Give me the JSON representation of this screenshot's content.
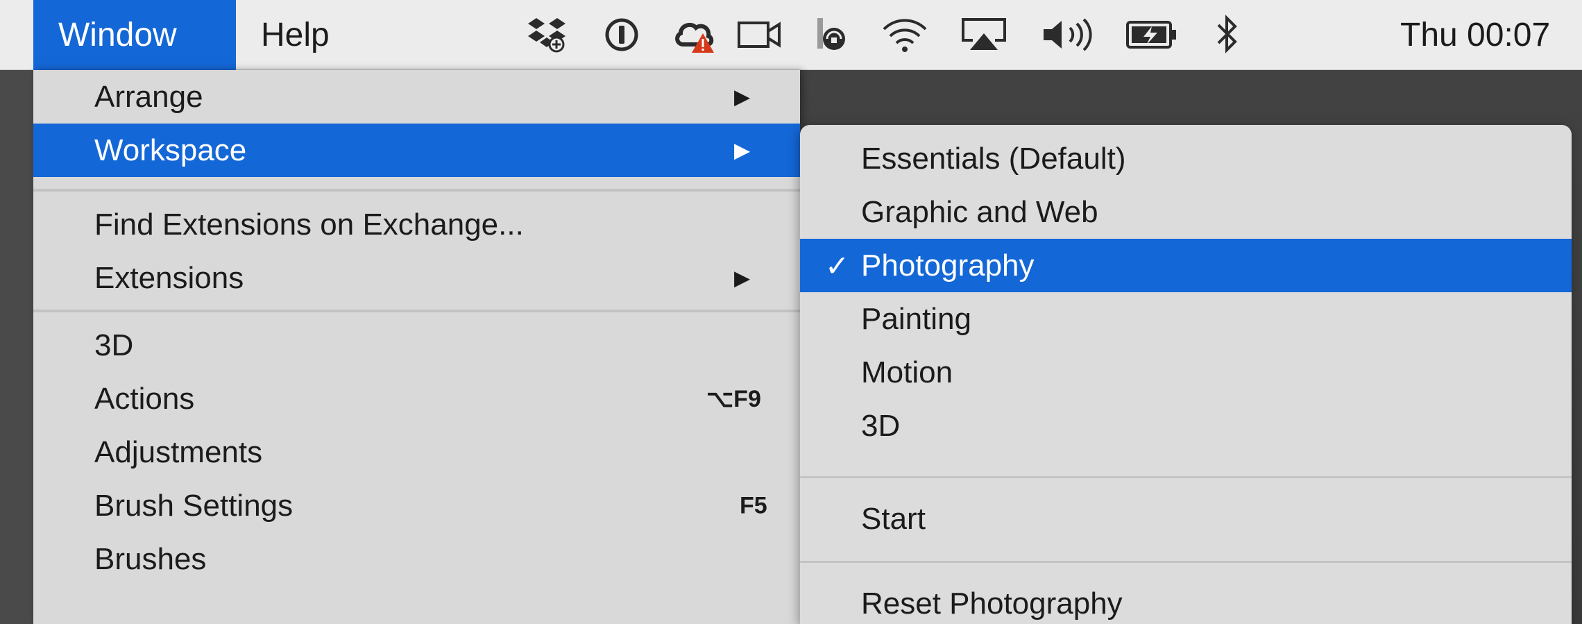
{
  "menubar": {
    "menus": [
      {
        "label": "Window"
      },
      {
        "label": "Help"
      }
    ],
    "status_icons": [
      "dropbox-icon",
      "1password-icon",
      "creative-cloud-icon",
      "camera-icon",
      "backblaze-icon",
      "wifi-icon",
      "airplay-icon",
      "volume-icon",
      "battery-icon",
      "bluetooth-icon"
    ],
    "clock": "Thu 00:07"
  },
  "window_menu": {
    "items": [
      {
        "label": "Arrange",
        "submenu": true
      },
      {
        "label": "Workspace",
        "submenu": true,
        "active": true
      },
      {
        "label": "Find Extensions on Exchange..."
      },
      {
        "label": "Extensions",
        "submenu": true
      },
      {
        "label": "3D"
      },
      {
        "label": "Actions",
        "shortcut": "⌥F9"
      },
      {
        "label": "Adjustments"
      },
      {
        "label": "Brush Settings",
        "shortcut": "F5"
      },
      {
        "label": "Brushes"
      }
    ]
  },
  "workspace_menu": {
    "items": [
      {
        "label": "Essentials (Default)"
      },
      {
        "label": "Graphic and Web"
      },
      {
        "label": "Photography",
        "checked": true,
        "active": true
      },
      {
        "label": "Painting"
      },
      {
        "label": "Motion"
      },
      {
        "label": "3D"
      },
      {
        "label": "Start"
      },
      {
        "label": "Reset Photography"
      }
    ],
    "checkmark": "✓"
  },
  "colors": {
    "accent": "#1467d6",
    "menubar_bg": "#ececec",
    "menu_bg": "#d9d9d9",
    "app_bg": "#3f3f3f"
  }
}
